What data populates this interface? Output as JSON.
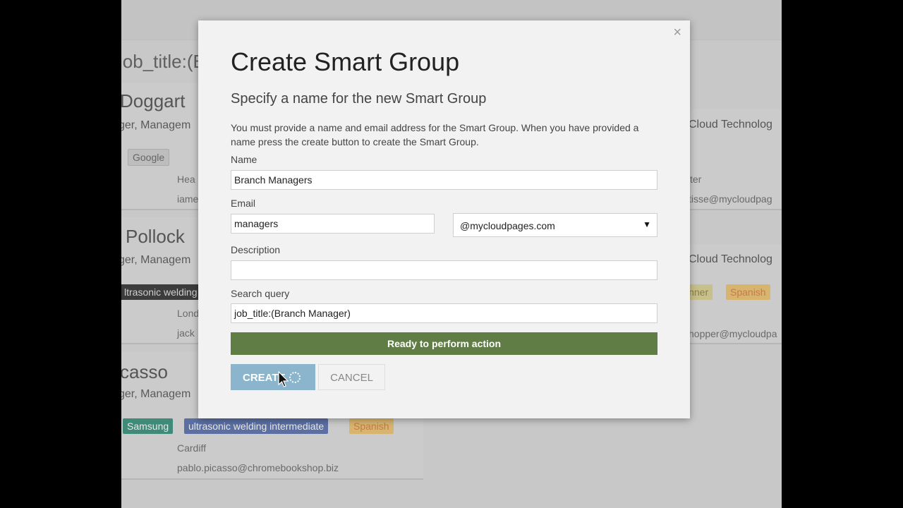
{
  "background": {
    "query_text": "job_title:(B",
    "cards_left": [
      {
        "name": "Doggart",
        "title": "ger, Managem",
        "tags": [
          {
            "label": "Google",
            "bg": "#bdbdbd",
            "fg": "#666"
          }
        ],
        "location": "Hea",
        "email": "iame"
      },
      {
        "name": "Pollock",
        "title": "ger, Managem",
        "tags": [
          {
            "label": "ltrasonic welding",
            "bg": "#3c3c3c",
            "fg": "#cfcfcf"
          }
        ],
        "location": "Lond",
        "email": "jack"
      },
      {
        "name": "casso",
        "title": "ger, Managem",
        "tags": [
          {
            "label": "Samsung",
            "bg": "#3f8a78",
            "fg": "#e8e8e8"
          },
          {
            "label": "ultrasonic welding intermediate",
            "bg": "#5b6fa3",
            "fg": "#e8e8e8"
          },
          {
            "label": "Spanish",
            "bg": "#d8b56f",
            "fg": "#c47b4a"
          }
        ],
        "location": "Cardiff",
        "email": "pablo.picasso@chromebookshop.biz"
      }
    ],
    "cards_right": [
      {
        "company": "Cloud Technolog",
        "line1": "ter",
        "line2": "tisse@mycloudpag",
        "tags": []
      },
      {
        "company": "Cloud Technolog",
        "line1": "",
        "line2": "hopper@mycloudpa",
        "tags": [
          {
            "label": "inner",
            "bg": "#c8c08a",
            "fg": "#8a7f4a"
          },
          {
            "label": "Spanish",
            "bg": "#d8b56f",
            "fg": "#c47b4a"
          }
        ]
      }
    ]
  },
  "modal": {
    "close_label": "×",
    "title": "Create Smart Group",
    "subtitle": "Specify a name for the new Smart Group",
    "description": "You must provide a name and email address for the Smart Group. When you have provided a name press the create button to create the Smart Group.",
    "fields": {
      "name_label": "Name",
      "name_value": "Branch Managers",
      "email_label": "Email",
      "email_value": "managers",
      "domain_value": "@mycloudpages.com",
      "domain_arrow": "▼",
      "description_label": "Description",
      "description_value": "",
      "search_label": "Search query",
      "search_value": "job_title:(Branch Manager)"
    },
    "status_text": "Ready to perform action",
    "create_label": "CREATE",
    "cancel_label": "CANCEL"
  }
}
